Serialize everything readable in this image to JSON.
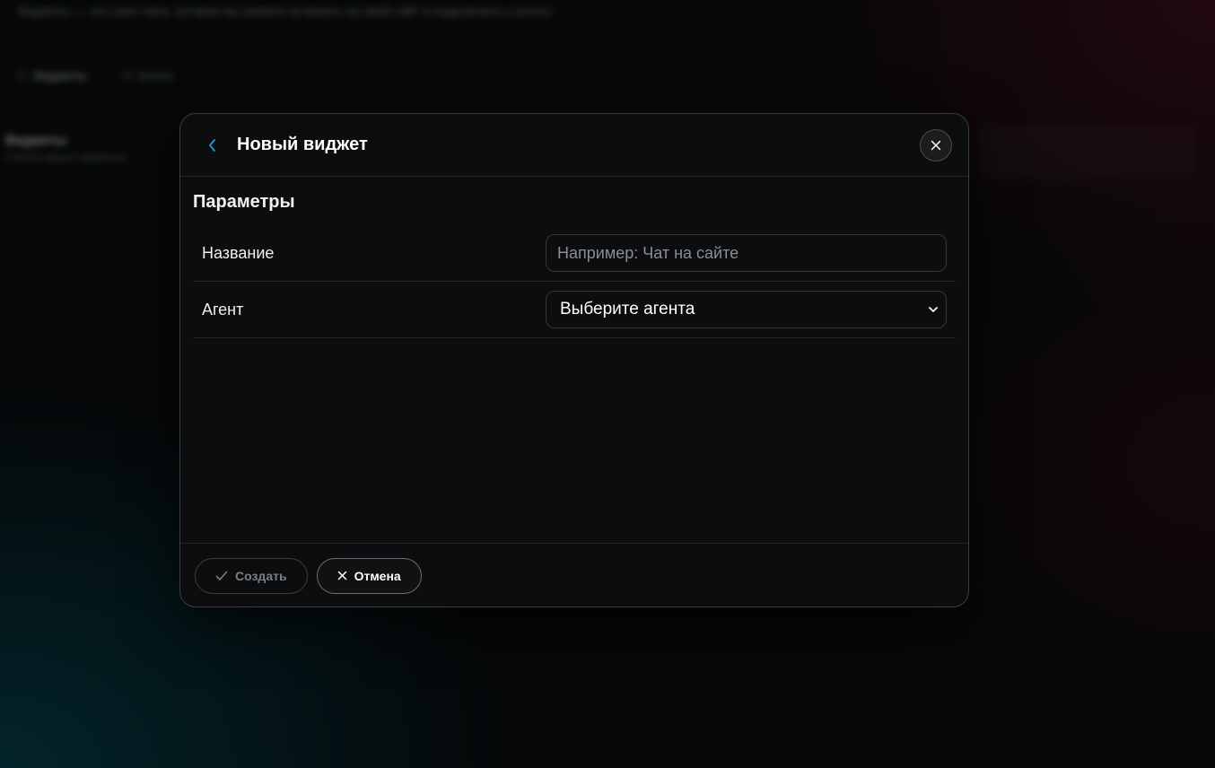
{
  "background": {
    "topline": "Виджеты — это окно чата, которое вы можете встроить на свой сайт и подключить к агенту",
    "tabs": [
      "Виджеты",
      "Блоки"
    ],
    "section_title": "Виджеты",
    "section_sub": "Список ваших виджетов"
  },
  "modal": {
    "title": "Новый виджет",
    "section_title": "Параметры",
    "fields": {
      "name": {
        "label": "Название",
        "value": "",
        "placeholder": "Например: Чат на сайте"
      },
      "agent": {
        "label": "Агент",
        "selected": "Выберите агента"
      }
    },
    "footer": {
      "create_label": "Создать",
      "cancel_label": "Отмена"
    }
  },
  "icons": {
    "back": "chevron-left-icon",
    "close": "close-icon",
    "select_arrow": "chevron-down-icon",
    "create": "check-icon",
    "cancel": "close-icon"
  },
  "colors": {
    "accent": "#1e9bd7",
    "modal_bg": "#0b0d0e",
    "border": "#3a3d40",
    "disabled_text": "#7c8084"
  }
}
